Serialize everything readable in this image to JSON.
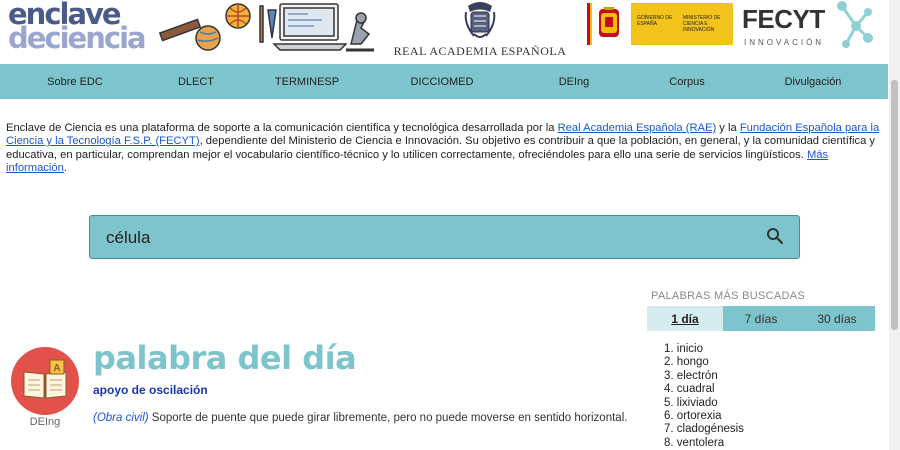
{
  "header": {
    "logo_line1": "enclave",
    "logo_line2": "deciencia",
    "rae_label": "REAL ACADEMIA ESPAÑOLA",
    "gob_text1": "GOBIERNO DE ESPAÑA",
    "gob_text2": "MINISTERIO DE CIENCIA E INNOVACIÓN",
    "fecyt_name": "FECYT",
    "fecyt_sub": "INNOVACIÓN"
  },
  "nav": {
    "items": [
      "Sobre EDC",
      "DLECT",
      "TERMINESP",
      "DICCIOMED",
      "DEIng",
      "Corpus",
      "Divulgación"
    ]
  },
  "intro": {
    "p1": "Enclave de Ciencia es una plataforma de soporte a la comunicación científica y tecnológica desarrollada por la ",
    "link_rae": "Real Academia Española (RAE)",
    "p2": " y la ",
    "link_fecyt": "Fundación Española para la Ciencia y la Tecnología F.S.P. (FECYT)",
    "p3": ", dependiente del Ministerio de Ciencia e Innovación. Su objetivo es contribuir a que la población, en general, y la comunidad científica y educativa, en particular, comprendan mejor el vocabulario científico-técnico y lo utilicen correctamente, ofreciéndoles para ello una serie de servicios lingüísticos. ",
    "link_more": "Más información"
  },
  "search": {
    "value": "célula"
  },
  "palabra_del_dia": {
    "title": "palabra del día",
    "word": "apoyo de oscilación",
    "field": "(Obra civil)",
    "definition": " Soporte de puente que puede girar libremente, pero no puede moverse en sentido horizontal.",
    "source": "DEIng"
  },
  "mas_buscadas": {
    "title": "PALABRAS MÁS BUSCADAS",
    "tabs": [
      "1 día",
      "7 días",
      "30 días"
    ],
    "items": [
      "inicio",
      "hongo",
      "electrón",
      "cuadral",
      "lixiviado",
      "ortorexia",
      "cladogénesis",
      "ventolera"
    ]
  },
  "colors": {
    "accent": "#7ec4cc",
    "link": "#1a57c9",
    "word": "#1a37a8"
  }
}
